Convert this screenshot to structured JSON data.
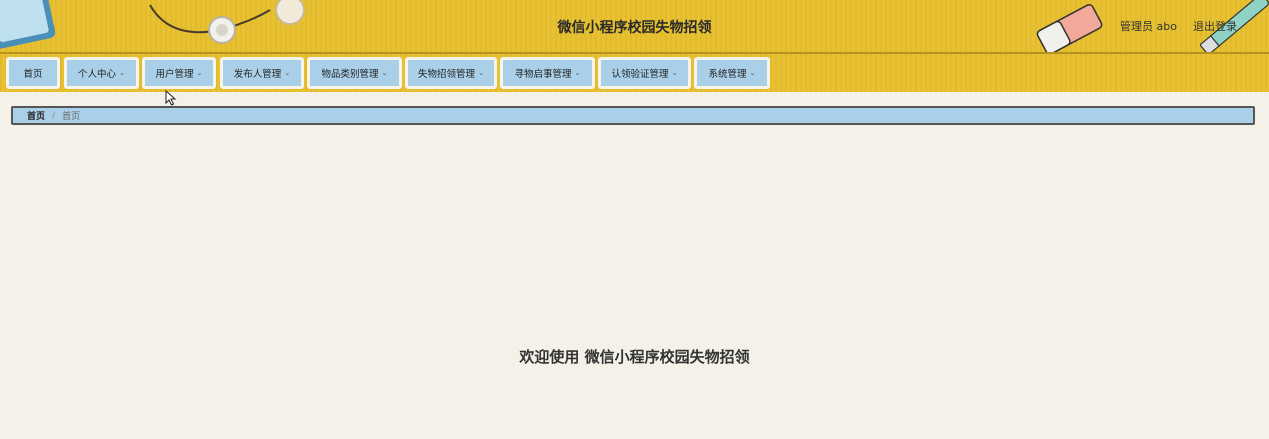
{
  "header": {
    "title": "微信小程序校园失物招领",
    "user_label": "管理员 abo",
    "logout_label": "退出登录"
  },
  "nav": {
    "items": [
      {
        "label": "首页",
        "has_dropdown": false
      },
      {
        "label": "个人中心",
        "has_dropdown": true
      },
      {
        "label": "用户管理",
        "has_dropdown": true
      },
      {
        "label": "发布人管理",
        "has_dropdown": true
      },
      {
        "label": "物品类别管理",
        "has_dropdown": true
      },
      {
        "label": "失物招领管理",
        "has_dropdown": true
      },
      {
        "label": "寻物启事管理",
        "has_dropdown": true
      },
      {
        "label": "认领验证管理",
        "has_dropdown": true
      },
      {
        "label": "系统管理",
        "has_dropdown": true
      }
    ],
    "chevron": "⌄"
  },
  "breadcrumb": {
    "home": "首页",
    "separator": "/",
    "current": "首页"
  },
  "main": {
    "welcome": "欢迎使用 微信小程序校园失物招领"
  },
  "colors": {
    "header_bg": "#e6bf2c",
    "nav_button_bg": "#a9d0e8",
    "page_bg": "#f4f1e8"
  }
}
